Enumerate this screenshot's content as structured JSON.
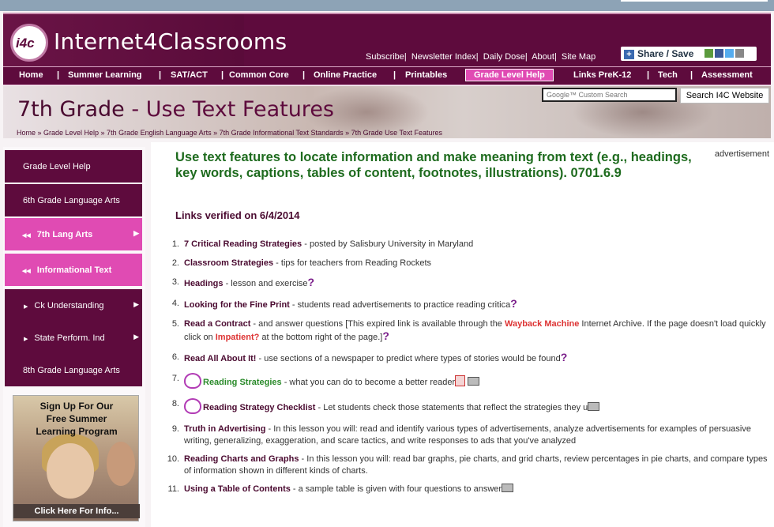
{
  "site": {
    "logo_badge": "i4c",
    "logo_text": "Internet4Classrooms",
    "top_links": [
      "Subscribe|",
      "Newsletter Index|",
      "Daily Dose|",
      "About|",
      "Site Map"
    ],
    "share_label": "Share / Save"
  },
  "nav": {
    "items": [
      {
        "label": "Home"
      },
      {
        "label": "Summer Learning"
      },
      {
        "label": "SAT/ACT"
      },
      {
        "label": "Common Core"
      },
      {
        "label": "Online Practice"
      },
      {
        "label": "Printables"
      },
      {
        "label": "Grade Level Help"
      },
      {
        "label": "Links PreK-12"
      },
      {
        "label": "Tech"
      },
      {
        "label": "Assessment"
      }
    ],
    "active": "Grade Level Help"
  },
  "banner": {
    "title_grade": "7th Grade",
    "title_rest": " - Use Text Features",
    "breadcrumb": "Home » Grade Level Help » 7th Grade English Language Arts » 7th Grade Informational Text Standards » 7th Grade Use Text Features",
    "search_placeholder": "Google™ Custom Search",
    "search_button": "Search I4C Website"
  },
  "sidebar": {
    "items": [
      {
        "label": "Grade Level Help",
        "style": "dark"
      },
      {
        "label": "6th Grade Language Arts",
        "style": "dark"
      },
      {
        "label": "7th Lang Arts",
        "style": "pink",
        "prefix": "◀◀",
        "arrow": "▶"
      },
      {
        "label": "Informational Text",
        "style": "pink",
        "prefix": "◀◀"
      },
      {
        "label": "Ck Understanding",
        "style": "dark",
        "prefix": "▶",
        "arrow": "▶"
      },
      {
        "label": "State Perform. Ind",
        "style": "dark",
        "prefix": "▶",
        "arrow": "▶"
      },
      {
        "label": "8th Grade Language Arts",
        "style": "dark"
      }
    ],
    "ad_top": [
      "Sign Up For Our",
      "Free Summer",
      "Learning Program"
    ],
    "ad_bottom": "Click Here For Info..."
  },
  "main": {
    "title": "Use text features to locate information and make meaning from text (e.g., headings, key words, captions, tables of content, footnotes, illustrations). 0701.6.9",
    "advertisement": "advertisement",
    "verified": "Links verified on 6/4/2014",
    "links": [
      {
        "n": "1.",
        "link": "7 Critical Reading Strategies",
        "text": " - posted by Salisbury University in Maryland"
      },
      {
        "n": "2.",
        "link": "Classroom Strategies",
        "text": " - tips for teachers from Reading Rockets"
      },
      {
        "n": "3.",
        "link": "Headings",
        "text": " - lesson and exercise"
      },
      {
        "n": "4.",
        "link": "Looking for the Fine Print",
        "text": " - students read advertisements to practice reading critica"
      },
      {
        "n": "5.",
        "link": "Read a Contract",
        "text": " - and answer questions [This expired link is available through the ",
        "red1": "Wayback Machine",
        "text2": " Internet Archive. If the page doesn't load quickly click on ",
        "red2": "Impatient?",
        "text3": " at the bottom right of the page.]"
      },
      {
        "n": "6.",
        "link": "Read All About It!",
        "text": " - use sections of a newspaper to predict where types of stories would be found"
      },
      {
        "n": "7.",
        "link": "Reading Strategies",
        "text": " - what you can do to become a better reader"
      },
      {
        "n": "8.",
        "link": "Reading Strategy Checklist",
        "text": " - Let students check those statements that reflect the strategies they u"
      },
      {
        "n": "9.",
        "link": "Truth in Advertising",
        "text": " - In this lesson you will: read and identify various types of advertisements, analyze advertisements for examples of persuasive writing, generalizing, exaggeration, and scare tactics, and write responses to ads that you've analyzed"
      },
      {
        "n": "10.",
        "link": "Reading Charts and Graphs",
        "text": " - In this lesson you will: read bar graphs, pie charts, and grid charts, review percentages in pie charts, and compare types of information shown in different kinds of charts."
      },
      {
        "n": "11.",
        "link": "Using a Table of Contents",
        "text": " - a sample table is given with four questions to answer"
      }
    ]
  }
}
